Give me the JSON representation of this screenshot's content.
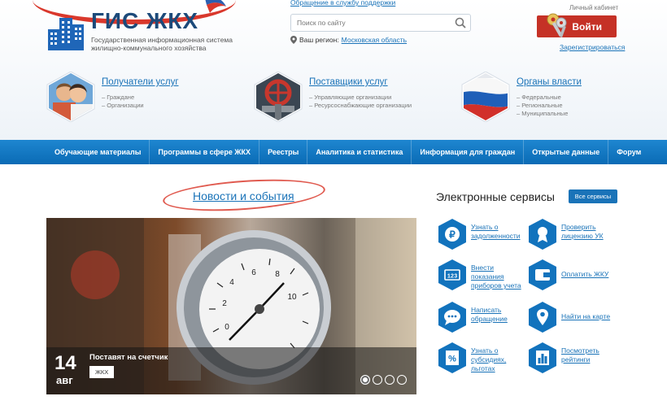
{
  "header": {
    "logo_title": "ГИС ЖКХ",
    "logo_subtitle": "Государственная информационная система жилищно-коммунального хозяйства",
    "support_link": "Обращение в службу поддержки",
    "search_placeholder": "Поиск по сайту",
    "region_label": "Ваш регион:",
    "region_value": "Московская область",
    "cabinet_label": "Личный кабинет",
    "login_label": "Войти",
    "register_label": "Зарегистрироваться"
  },
  "categories": [
    {
      "title": "Получатели услуг",
      "items": [
        "– Граждане",
        "– Организации"
      ]
    },
    {
      "title": "Поставщики услуг",
      "items": [
        "– Управляющие организации",
        "– Ресурсоснабжающие организации"
      ]
    },
    {
      "title": "Органы власти",
      "items": [
        "– Федеральные",
        "– Региональные",
        "– Муниципальные"
      ]
    }
  ],
  "nav": [
    "Обучающие материалы",
    "Программы в сфере ЖКХ",
    "Реестры",
    "Аналитика и статистика",
    "Информация для граждан",
    "Открытые данные",
    "Форум"
  ],
  "news": {
    "section_title": "Новости и события",
    "day": "14",
    "month": "авг",
    "caption": "Поставят на счетчик",
    "tag": "ЖКХ",
    "slides": 4,
    "active_slide": 1
  },
  "services": {
    "title": "Электронные сервисы",
    "all_label": "Все сервисы",
    "items": [
      {
        "label": "Узнать о задолженности",
        "icon": "ruble-icon"
      },
      {
        "label": "Проверить лицензию УК",
        "icon": "license-icon"
      },
      {
        "label": "Внести показания приборов учета",
        "icon": "meter-icon"
      },
      {
        "label": "Оплатить ЖКУ",
        "icon": "wallet-icon"
      },
      {
        "label": "Написать обращение",
        "icon": "chat-icon"
      },
      {
        "label": "Найти на карте",
        "icon": "map-pin-icon"
      },
      {
        "label": "Узнать о субсидиях, льготах",
        "icon": "percent-icon"
      },
      {
        "label": "Посмотреть рейтинги",
        "icon": "rating-icon"
      }
    ]
  },
  "colors": {
    "brand_blue": "#1a73b8",
    "nav_blue": "#0a6bb5",
    "login_red": "#c53126",
    "hex_blue": "#1273bd"
  }
}
